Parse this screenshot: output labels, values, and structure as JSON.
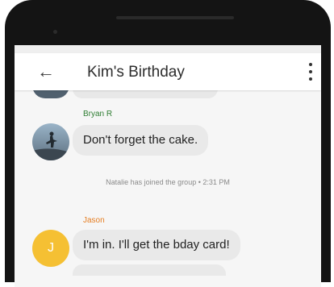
{
  "header": {
    "back_icon": "arrow-left-icon",
    "title": "Kim's Birthday",
    "menu_icon": "more-vert-icon"
  },
  "messages": [
    {
      "sender": "Bryan R",
      "text": "Don't forget the cake.",
      "sender_color": "#2e7d32"
    },
    {
      "sender": "Jason",
      "text": "I'm in. I'll get the bday card!",
      "sender_color": "#e67e22",
      "avatar_initial": "J"
    }
  ],
  "system_message": "Natalie has joined the group • 2:31 PM",
  "colors": {
    "accent_yellow": "#f5c033",
    "bubble": "#e9e9e9"
  }
}
